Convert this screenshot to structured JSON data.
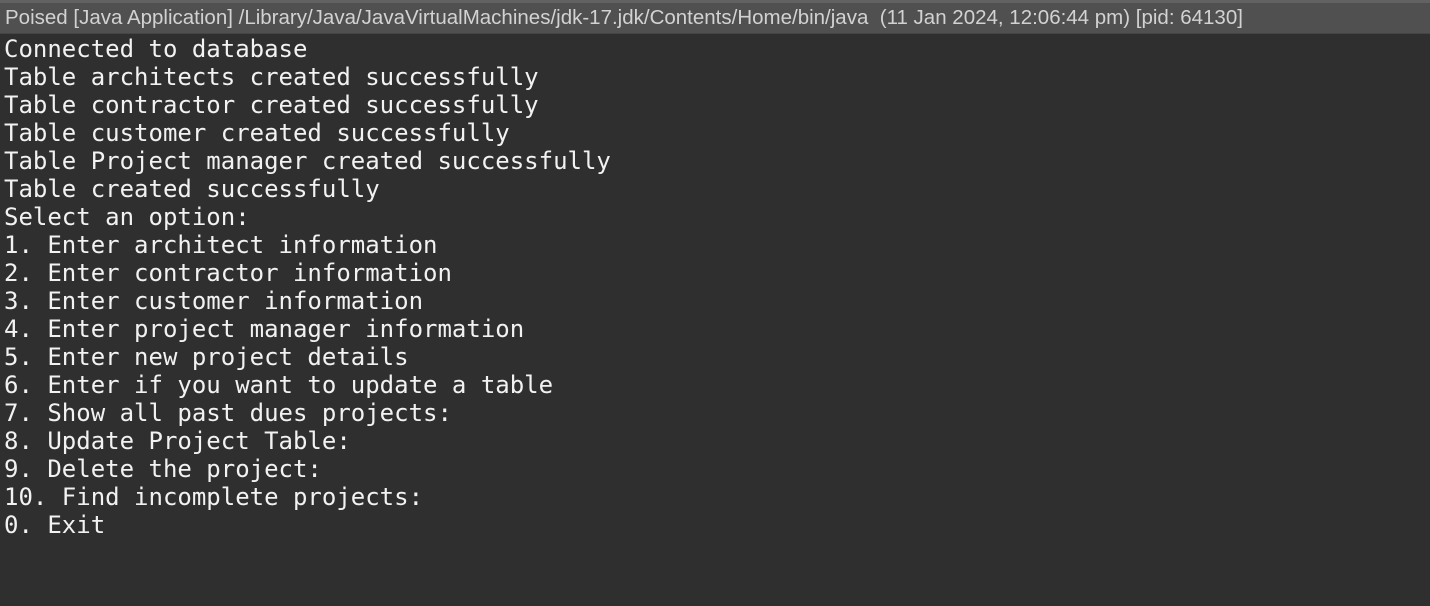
{
  "console": {
    "title": "Poised [Java Application] /Library/Java/JavaVirtualMachines/jdk-17.jdk/Contents/Home/bin/java  (11 Jan 2024, 12:06:44 pm) [pid: 64130]",
    "lines": [
      "Connected to database",
      "Table architects created successfully",
      "Table contractor created successfully",
      "Table customer created successfully",
      "Table Project manager created successfully",
      "Table created successfully",
      "Select an option:",
      "1. Enter architect information",
      "2. Enter contractor information",
      "3. Enter customer information",
      "4. Enter project manager information",
      "5. Enter new project details",
      "6. Enter if you want to update a table",
      "7. Show all past dues projects:",
      "8. Update Project Table:",
      "9. Delete the project:",
      "10. Find incomplete projects:",
      "0. Exit"
    ]
  }
}
